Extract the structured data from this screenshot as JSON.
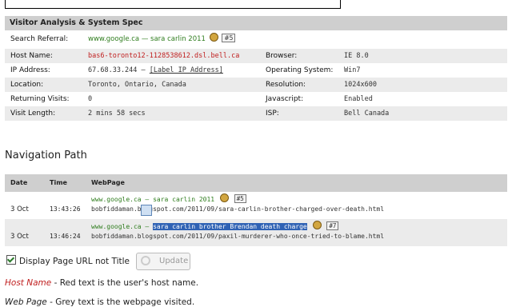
{
  "spec": {
    "title": "Visitor Analysis & System Spec",
    "referral_label": "Search Referral:",
    "referral_text": "www.google.ca — sara carlin 2011",
    "referral_rank": "#5",
    "host_label": "Host Name:",
    "host_value": "bas6-toronto12-1128538612.dsl.bell.ca",
    "browser_label": "Browser:",
    "browser_value": "IE 8.0",
    "ip_label": "IP Address:",
    "ip_value": "67.68.33.244 —",
    "ip_link": "[Label IP Address]",
    "os_label": "Operating System:",
    "os_value": "Win7",
    "location_label": "Location:",
    "location_value": "Toronto, Ontario, Canada",
    "resolution_label": "Resolution:",
    "resolution_value": "1024x600",
    "returning_label": "Returning Visits:",
    "returning_value": "0",
    "javascript_label": "Javascript:",
    "javascript_value": "Enabled",
    "visit_label": "Visit Length:",
    "visit_value": "2 mins 58 secs",
    "isp_label": "ISP:",
    "isp_value": "Bell Canada"
  },
  "nav": {
    "title": "Navigation Path",
    "col_date": "Date",
    "col_time": "Time",
    "col_page": "WebPage",
    "rows": [
      {
        "date": "3 Oct",
        "time": "13:43:26",
        "ref": "www.google.ca — sara carlin 2011",
        "ref_selected": "",
        "rank": "#5",
        "page": "bobfiddaman.blogspot.com/2011/09/sara-carlin-brother-charged-over-death.html"
      },
      {
        "date": "3 Oct",
        "time": "13:46:24",
        "ref": "www.google.ca — ",
        "ref_selected": "sara carlin brother Brendan death charge",
        "rank": "#7",
        "page": "bobfiddaman.blogspot.com/2011/09/paxil-murderer-who-once-tried-to-blame.html"
      }
    ]
  },
  "controls": {
    "checkbox_label": "Display Page URL not Title",
    "checkbox_checked": true,
    "update_label": "Update"
  },
  "legend": {
    "host_key": "Host Name",
    "host_desc": " - Red text is the user's host name.",
    "page_key": "Web Page",
    "page_desc": " - Grey text is the webpage visited."
  },
  "colors": {
    "referral_green": "#2f7d1e",
    "host_red": "#c02020",
    "header_grey": "#cfcfcf",
    "selection_blue": "#2f62b4"
  }
}
